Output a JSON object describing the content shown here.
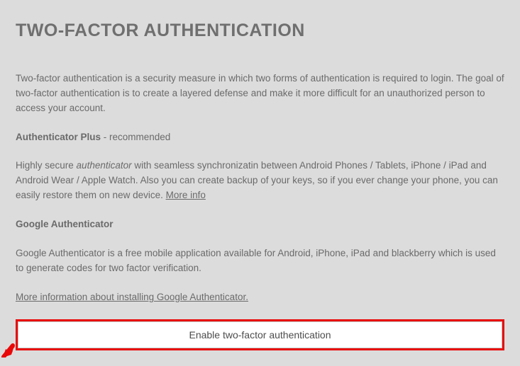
{
  "heading": "TWO-FACTOR AUTHENTICATION",
  "intro": "Two-factor authentication is a security measure in which two forms of authentication is required to login. The goal of two-factor authentication is to create a layered defense and make it more difficult for an unauthorized person to access your account.",
  "auth_plus": {
    "name": "Authenticator Plus",
    "suffix": " - recommended",
    "desc_prefix": "Highly secure ",
    "desc_emph": "authenticator",
    "desc_suffix": " with seamless synchronizatin between Android Phones / Tablets, iPhone / iPad and Android Wear / Apple Watch. Also you can create backup of your keys, so if you ever change your phone, you can easily restore them on new device. ",
    "more_info": "More info"
  },
  "google": {
    "name": "Google Authenticator",
    "desc": "Google Authenticator is a free mobile application available for Android, iPhone, iPad and blackberry which is used to generate codes for two factor verification.",
    "more_link": "More information about installing Google Authenticator."
  },
  "button_label": "Enable two-factor authentication"
}
